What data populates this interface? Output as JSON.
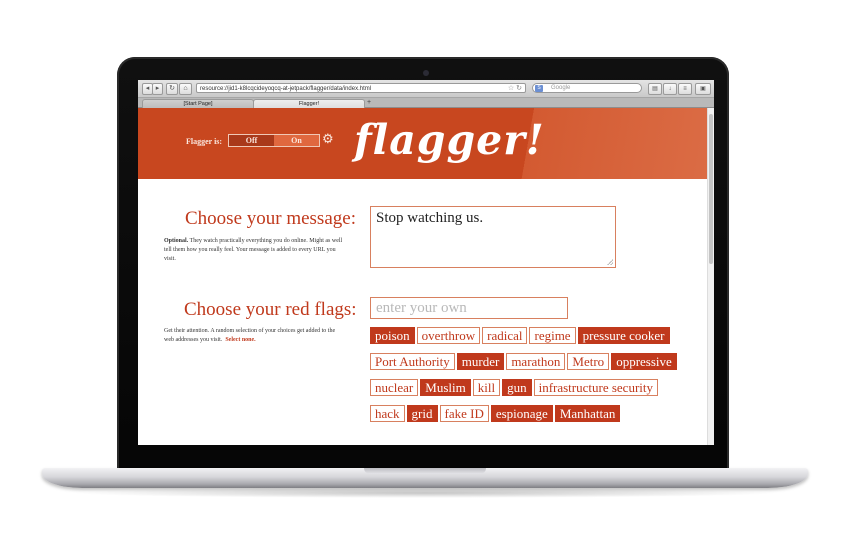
{
  "browser": {
    "url": "resource://jid1-k8lcqcideyoqcq-at-jetpack/flagger/data/index.html",
    "search_placeholder": "Google",
    "tabs": [
      {
        "label": "[Start Page]",
        "active": false
      },
      {
        "label": "Flagger!",
        "active": true
      }
    ],
    "new_tab_label": "+"
  },
  "header": {
    "toggle_label": "Flagger is:",
    "off_label": "Off",
    "on_label": "On",
    "state": "on",
    "logo": "flagger!"
  },
  "message_section": {
    "title": "Choose your message:",
    "help_bold": "Optional.",
    "help_text": "They watch practically everything you do online. Might as well tell them how you really feel. Your message is added to every URL you visit.",
    "message_value": "Stop watching us."
  },
  "flags_section": {
    "title": "Choose your red flags:",
    "help_text": "Get their attention. A random selection of your choices get added to the web addresses you visit.",
    "select_none": "Select none.",
    "input_placeholder": "enter your own",
    "tags": [
      {
        "label": "poison",
        "selected": true
      },
      {
        "label": "overthrow",
        "selected": false
      },
      {
        "label": "radical",
        "selected": false
      },
      {
        "label": "regime",
        "selected": false
      },
      {
        "label": "pressure cooker",
        "selected": true
      },
      {
        "label": "Port Authority",
        "selected": false
      },
      {
        "label": "murder",
        "selected": true
      },
      {
        "label": "marathon",
        "selected": false
      },
      {
        "label": "Metro",
        "selected": false
      },
      {
        "label": "oppressive",
        "selected": true
      },
      {
        "label": "nuclear",
        "selected": false
      },
      {
        "label": "Muslim",
        "selected": true
      },
      {
        "label": "kill",
        "selected": false
      },
      {
        "label": "gun",
        "selected": true
      },
      {
        "label": "infrastructure security",
        "selected": false
      },
      {
        "label": "hack",
        "selected": false
      },
      {
        "label": "grid",
        "selected": true
      },
      {
        "label": "fake ID",
        "selected": false
      },
      {
        "label": "espionage",
        "selected": true
      },
      {
        "label": "Manhattan",
        "selected": true
      }
    ]
  },
  "colors": {
    "accent": "#c0391c",
    "header_bg": "#c8471f"
  }
}
